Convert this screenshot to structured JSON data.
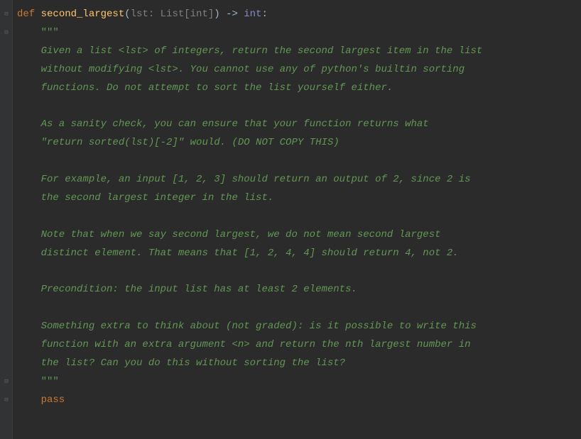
{
  "code": {
    "lines": [
      {
        "kind": "sig",
        "indent": 0,
        "tokens": [
          {
            "cls": "kw",
            "t": "def "
          },
          {
            "cls": "fn",
            "t": "second_largest"
          },
          {
            "cls": "punct",
            "t": "("
          },
          {
            "cls": "param",
            "t": "lst: List[int]"
          },
          {
            "cls": "punct",
            "t": ")"
          },
          {
            "cls": "op",
            "t": " -> "
          },
          {
            "cls": "builtin",
            "t": "int"
          },
          {
            "cls": "punct",
            "t": ":"
          }
        ]
      },
      {
        "kind": "tripq",
        "indent": 4,
        "text": "\"\"\""
      },
      {
        "kind": "doc",
        "indent": 4,
        "text": "Given a list <lst> of integers, return the second largest item in the list"
      },
      {
        "kind": "doc",
        "indent": 4,
        "text": "without modifying <lst>. You cannot use any of python's builtin sorting"
      },
      {
        "kind": "doc",
        "indent": 4,
        "text": "functions. Do not attempt to sort the list yourself either."
      },
      {
        "kind": "blank"
      },
      {
        "kind": "doc",
        "indent": 4,
        "text": "As a sanity check, you can ensure that your function returns what"
      },
      {
        "kind": "doc",
        "indent": 4,
        "text": "\"return sorted(lst)[-2]\" would. (DO NOT COPY THIS)"
      },
      {
        "kind": "blank"
      },
      {
        "kind": "doc",
        "indent": 4,
        "text": "For example, an input [1, 2, 3] should return an output of 2, since 2 is"
      },
      {
        "kind": "doc",
        "indent": 4,
        "text": "the second largest integer in the list."
      },
      {
        "kind": "blank"
      },
      {
        "kind": "doc",
        "indent": 4,
        "text": "Note that when we say second largest, we do not mean second largest"
      },
      {
        "kind": "doc",
        "indent": 4,
        "text": "distinct element. That means that [1, 2, 4, 4] should return 4, not 2."
      },
      {
        "kind": "blank"
      },
      {
        "kind": "doc",
        "indent": 4,
        "text": "Precondition: the input list has at least 2 elements."
      },
      {
        "kind": "blank"
      },
      {
        "kind": "doc",
        "indent": 4,
        "text": "Something extra to think about (not graded): is it possible to write this"
      },
      {
        "kind": "doc",
        "indent": 4,
        "text": "function with an extra argument <n> and return the nth largest number in"
      },
      {
        "kind": "doc",
        "indent": 4,
        "text": "the list? Can you do this without sorting the list?"
      },
      {
        "kind": "tripq",
        "indent": 4,
        "text": "\"\"\""
      },
      {
        "kind": "kw",
        "indent": 4,
        "text": "pass"
      }
    ]
  },
  "gutter": {
    "fold_markers": [
      {
        "line_index": 0,
        "glyph": "⊟"
      },
      {
        "line_index": 1,
        "glyph": "⊟"
      },
      {
        "line_index": 20,
        "glyph": "⊟"
      },
      {
        "line_index": 21,
        "glyph": "⊟"
      }
    ]
  },
  "colors": {
    "background": "#2b2b2b",
    "gutter_bg": "#313335",
    "keyword": "#cc7832",
    "function": "#ffc66d",
    "param": "#808080",
    "builtin": "#8888c6",
    "docstring": "#629755",
    "default": "#a9b7c6"
  }
}
